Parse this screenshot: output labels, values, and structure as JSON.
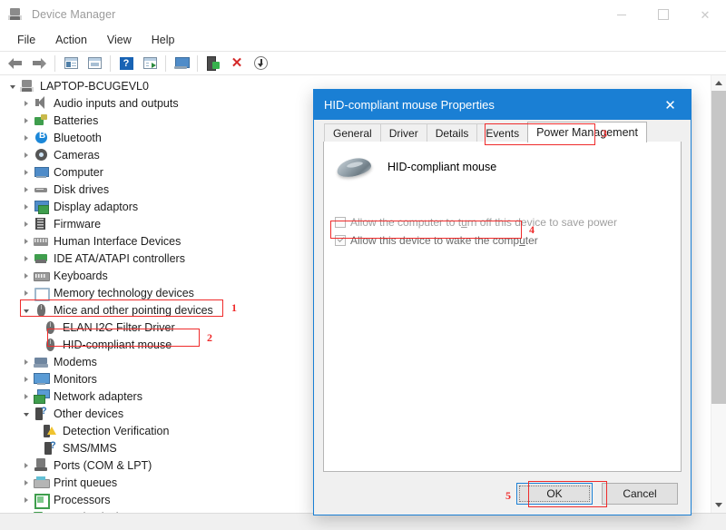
{
  "window": {
    "title": "Device Manager",
    "icon": "device-manager-icon",
    "controls": {
      "minimize": "–",
      "maximize": "□",
      "close": "✕"
    }
  },
  "menu": [
    {
      "label": "File"
    },
    {
      "label": "Action"
    },
    {
      "label": "View"
    },
    {
      "label": "Help"
    }
  ],
  "toolbar": [
    {
      "name": "back-icon",
      "title": "Back"
    },
    {
      "name": "forward-icon",
      "title": "Forward"
    },
    {
      "name": "separator-1"
    },
    {
      "name": "show-hide-console-tree-icon",
      "title": "Show/Hide Console Tree"
    },
    {
      "name": "properties-icon",
      "title": "Properties"
    },
    {
      "name": "separator-2"
    },
    {
      "name": "help-icon",
      "title": "Help"
    },
    {
      "name": "update-driver-icon",
      "title": "Update Driver"
    },
    {
      "name": "separator-3"
    },
    {
      "name": "scan-for-hardware-changes-icon",
      "title": "Scan for hardware changes"
    },
    {
      "name": "separator-4"
    },
    {
      "name": "enable-device-icon",
      "title": "Enable device"
    },
    {
      "name": "uninstall-device-icon",
      "title": "Uninstall device"
    },
    {
      "name": "disable-device-icon",
      "title": "Disable device"
    }
  ],
  "tree": [
    {
      "label": "LAPTOP-BCUGEVL0",
      "level": 0,
      "state": "open",
      "icon": "computer-root-icon",
      "icon_class": "ic-pc"
    },
    {
      "label": "Audio inputs and outputs",
      "level": 1,
      "state": "closed",
      "icon": "audio-icon",
      "icon_class": "ic-audio"
    },
    {
      "label": "Batteries",
      "level": 1,
      "state": "closed",
      "icon": "battery-icon",
      "icon_class": "ic-batt"
    },
    {
      "label": "Bluetooth",
      "level": 1,
      "state": "closed",
      "icon": "bluetooth-icon",
      "icon_class": "ic-bt"
    },
    {
      "label": "Cameras",
      "level": 1,
      "state": "closed",
      "icon": "camera-icon",
      "icon_class": "ic-cam"
    },
    {
      "label": "Computer",
      "level": 1,
      "state": "closed",
      "icon": "computer-icon",
      "icon_class": "ic-comp"
    },
    {
      "label": "Disk drives",
      "level": 1,
      "state": "closed",
      "icon": "disk-drive-icon",
      "icon_class": "ic-disk"
    },
    {
      "label": "Display adaptors",
      "level": 1,
      "state": "closed",
      "icon": "display-adaptor-icon",
      "icon_class": "ic-display"
    },
    {
      "label": "Firmware",
      "level": 1,
      "state": "closed",
      "icon": "firmware-icon",
      "icon_class": "ic-firm"
    },
    {
      "label": "Human Interface Devices",
      "level": 1,
      "state": "closed",
      "icon": "hid-icon",
      "icon_class": "ic-hid"
    },
    {
      "label": "IDE ATA/ATAPI controllers",
      "level": 1,
      "state": "closed",
      "icon": "ide-controller-icon",
      "icon_class": "ic-ide"
    },
    {
      "label": "Keyboards",
      "level": 1,
      "state": "closed",
      "icon": "keyboard-icon",
      "icon_class": "ic-kb"
    },
    {
      "label": "Memory technology devices",
      "level": 1,
      "state": "closed",
      "icon": "memory-device-icon",
      "icon_class": "ic-mem"
    },
    {
      "label": "Mice and other pointing devices",
      "level": 1,
      "state": "open",
      "icon": "mouse-icon",
      "icon_class": "ic-mouse"
    },
    {
      "label": "ELAN I2C Filter Driver",
      "level": 2,
      "state": "none",
      "icon": "mouse-icon",
      "icon_class": "ic-mouse"
    },
    {
      "label": "HID-compliant mouse",
      "level": 2,
      "state": "none",
      "icon": "mouse-icon",
      "icon_class": "ic-mouse"
    },
    {
      "label": "Modems",
      "level": 1,
      "state": "closed",
      "icon": "modem-icon",
      "icon_class": "ic-modem"
    },
    {
      "label": "Monitors",
      "level": 1,
      "state": "closed",
      "icon": "monitor-icon",
      "icon_class": "ic-mon"
    },
    {
      "label": "Network adapters",
      "level": 1,
      "state": "closed",
      "icon": "network-adapter-icon",
      "icon_class": "ic-net"
    },
    {
      "label": "Other devices",
      "level": 1,
      "state": "open",
      "icon": "other-device-icon",
      "icon_class": "ic-other"
    },
    {
      "label": "Detection Verification",
      "level": 2,
      "state": "none",
      "icon": "warning-device-icon",
      "icon_class": "ic-warn"
    },
    {
      "label": "SMS/MMS",
      "level": 2,
      "state": "none",
      "icon": "other-device-icon",
      "icon_class": "ic-other"
    },
    {
      "label": "Ports (COM & LPT)",
      "level": 1,
      "state": "closed",
      "icon": "port-icon",
      "icon_class": "ic-port"
    },
    {
      "label": "Print queues",
      "level": 1,
      "state": "closed",
      "icon": "printer-icon",
      "icon_class": "ic-print"
    },
    {
      "label": "Processors",
      "level": 1,
      "state": "closed",
      "icon": "processor-icon",
      "icon_class": "ic-cpu"
    },
    {
      "label": "Security devices",
      "level": 1,
      "state": "closed",
      "icon": "security-device-icon",
      "icon_class": "ic-sec"
    }
  ],
  "scrollbar": {
    "up": "▲",
    "down": "▼"
  },
  "dialog": {
    "title": "HID-compliant mouse Properties",
    "close": "✕",
    "tabs": [
      {
        "label": "General",
        "active": false
      },
      {
        "label": "Driver",
        "active": false
      },
      {
        "label": "Details",
        "active": false
      },
      {
        "label": "Events",
        "active": false
      },
      {
        "label": "Power Management",
        "active": true
      }
    ],
    "device_name": "HID-compliant mouse",
    "device_icon": "mouse-illustration-icon",
    "checkboxes": [
      {
        "label_pre": "Allow the computer to t",
        "label_accel": "u",
        "label_post": "rn off this device to save power",
        "checked": false,
        "disabled": true,
        "name": "allow-turn-off-device-checkbox"
      },
      {
        "label_pre": "Allow this device to wake the comp",
        "label_accel": "u",
        "label_post": "ter",
        "checked": true,
        "disabled": true,
        "name": "allow-wake-computer-checkbox"
      }
    ],
    "buttons": [
      {
        "label": "OK",
        "focused": true,
        "name": "ok-button"
      },
      {
        "label": "Cancel",
        "focused": false,
        "name": "cancel-button"
      }
    ]
  },
  "annotations": [
    {
      "num": "1",
      "target": "mice-and-other-pointing-devices-row"
    },
    {
      "num": "2",
      "target": "hid-compliant-mouse-row"
    },
    {
      "num": "3",
      "target": "power-management-tab"
    },
    {
      "num": "4",
      "target": "allow-wake-computer-checkbox"
    },
    {
      "num": "5",
      "target": "ok-button"
    }
  ],
  "colors": {
    "accent": "#1a7fd4",
    "annotation": "#ef2b2b",
    "title_text": "#9b9b9b",
    "dialog_bg": "#f0f0f0"
  }
}
